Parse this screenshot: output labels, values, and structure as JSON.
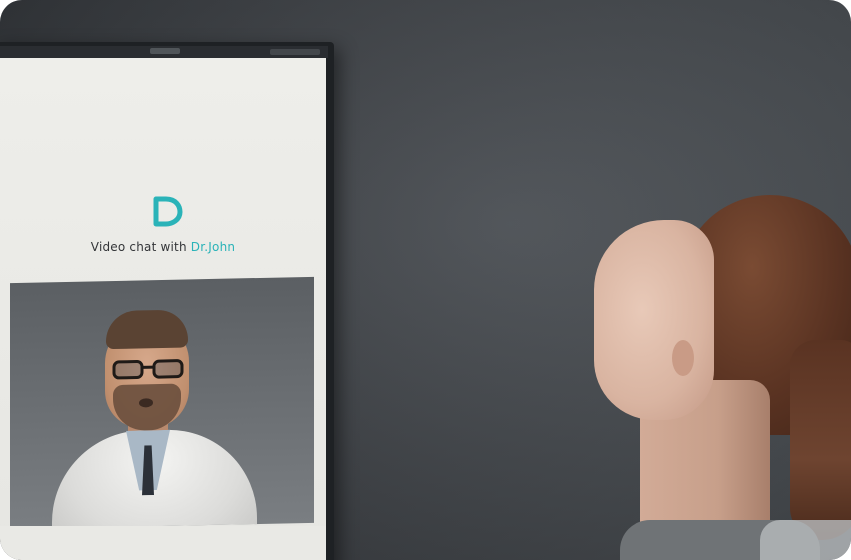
{
  "screen": {
    "title_prefix": "Video chat with ",
    "doctor_name": "Dr.John",
    "logo_icon": "heart-chat-icon",
    "accent_color": "#2ab3b8"
  },
  "scene": {
    "video_feed": "doctor-video",
    "person": "patient-woman"
  }
}
